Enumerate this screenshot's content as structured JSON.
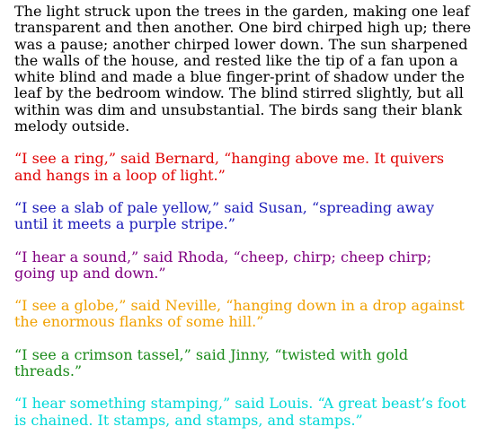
{
  "intro": "The light struck upon the trees in the garden, making one leaf transparent and then another. One bird chirped high up; there was a pause; another chirped lower down. The sun sharpened the walls of the house, and rested like the tip of a fan upon a white blind and made a blue finger-print of shadow under the leaf by the bedroom window. The blind stirred slightly, but all within was dim and unsubstantial. The birds sang their blank melody outside.",
  "lines": [
    {
      "text": "“I see a ring,” said Bernard, “hanging above me. It quivers and hangs in a loop of light.”",
      "color": "#e00000"
    },
    {
      "text": "“I see a slab of pale yellow,” said Susan, “spreading away until it meets a purple stripe.”",
      "color": "#1a1ab8"
    },
    {
      "text": "“I hear a sound,” said Rhoda, “cheep, chirp; cheep chirp; going up and down.”",
      "color": "#800080"
    },
    {
      "text": "“I see a globe,” said Neville, “hanging down in a drop against the enormous flanks of some hill.”",
      "color": "#f0a000"
    },
    {
      "text": "“I see a crimson tassel,” said Jinny, “twisted with gold threads.”",
      "color": "#1a8a1a"
    },
    {
      "text": "“I hear something stamping,” said Louis. “A great beast’s foot is chained. It stamps, and stamps, and stamps.”",
      "color": "#00d8d8"
    }
  ]
}
